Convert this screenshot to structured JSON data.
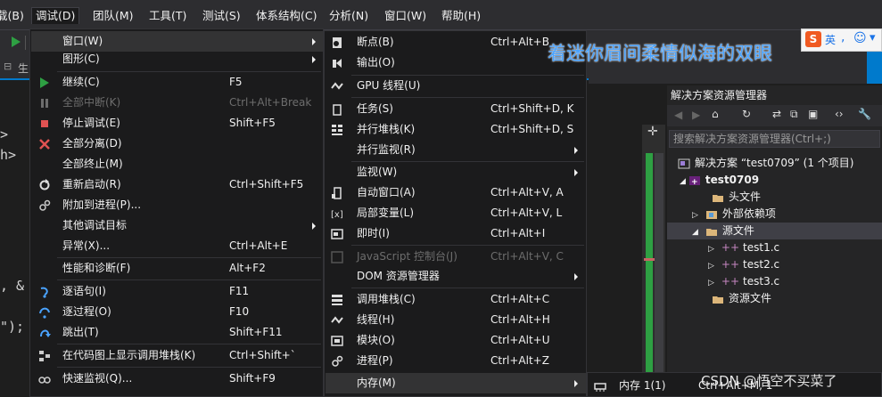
{
  "menubar": {
    "items": [
      "载(B)",
      "调试(D)",
      "团队(M)",
      "工具(T)",
      "测试(S)",
      "体系结构(C)",
      "分析(N)",
      "窗口(W)",
      "帮助(H)"
    ]
  },
  "toolbar": {
    "tab_label": "生"
  },
  "editor": {
    "lines": [
      ">",
      "h>",
      ", &",
      "\");"
    ]
  },
  "overlay_text": "着迷你眉间柔情似海的双眼",
  "ime": {
    "logo": "S",
    "label": "英"
  },
  "debug_menu": {
    "items": [
      {
        "label": "窗口(W)",
        "shortcut": "",
        "submenu": true,
        "icon": "",
        "disabled": false,
        "highlight": true
      },
      {
        "label": "图形(C)",
        "shortcut": "",
        "submenu": true,
        "icon": "",
        "disabled": false
      },
      {
        "label": "继续(C)",
        "shortcut": "F5",
        "icon": "play-icon",
        "disabled": false
      },
      {
        "label": "全部中断(K)",
        "shortcut": "Ctrl+Alt+Break",
        "icon": "pause-icon",
        "disabled": true
      },
      {
        "label": "停止调试(E)",
        "shortcut": "Shift+F5",
        "icon": "stop-icon",
        "disabled": false
      },
      {
        "label": "全部分离(D)",
        "shortcut": "",
        "icon": "detach-icon",
        "disabled": false
      },
      {
        "label": "全部终止(M)",
        "shortcut": "",
        "icon": "",
        "disabled": false
      },
      {
        "label": "重新启动(R)",
        "shortcut": "Ctrl+Shift+F5",
        "icon": "restart-icon",
        "disabled": false
      },
      {
        "label": "附加到进程(P)...",
        "shortcut": "",
        "icon": "attach-icon",
        "disabled": false
      },
      {
        "label": "其他调试目标",
        "shortcut": "",
        "submenu": true,
        "icon": "",
        "disabled": false
      },
      {
        "label": "异常(X)...",
        "shortcut": "Ctrl+Alt+E",
        "icon": "",
        "disabled": false
      },
      {
        "label": "性能和诊断(F)",
        "shortcut": "Alt+F2",
        "icon": "",
        "disabled": false
      },
      {
        "label": "逐语句(I)",
        "shortcut": "F11",
        "icon": "step-into-icon",
        "disabled": false
      },
      {
        "label": "逐过程(O)",
        "shortcut": "F10",
        "icon": "step-over-icon",
        "disabled": false
      },
      {
        "label": "跳出(T)",
        "shortcut": "Shift+F11",
        "icon": "step-out-icon",
        "disabled": false
      },
      {
        "label": "在代码图上显示调用堆栈(K)",
        "shortcut": "Ctrl+Shift+`",
        "icon": "code-map-icon",
        "disabled": false
      },
      {
        "label": "快速监视(Q)...",
        "shortcut": "Shift+F9",
        "icon": "glasses-icon",
        "disabled": false
      }
    ]
  },
  "window_submenu": {
    "items": [
      {
        "label": "断点(B)",
        "shortcut": "Ctrl+Alt+B",
        "icon": "breakpoints-icon"
      },
      {
        "label": "输出(O)",
        "shortcut": "",
        "icon": "output-icon"
      },
      {
        "label": "GPU 线程(U)",
        "shortcut": "",
        "icon": "gpu-threads-icon"
      },
      {
        "label": "任务(S)",
        "shortcut": "Ctrl+Shift+D, K",
        "icon": "tasks-icon"
      },
      {
        "label": "并行堆栈(K)",
        "shortcut": "Ctrl+Shift+D, S",
        "icon": "parallel-stacks-icon"
      },
      {
        "label": "并行监视(R)",
        "shortcut": "",
        "submenu": true,
        "icon": ""
      },
      {
        "label": "监视(W)",
        "shortcut": "",
        "submenu": true,
        "icon": ""
      },
      {
        "label": "自动窗口(A)",
        "shortcut": "Ctrl+Alt+V, A",
        "icon": "autos-icon"
      },
      {
        "label": "局部变量(L)",
        "shortcut": "Ctrl+Alt+V, L",
        "icon": "locals-icon"
      },
      {
        "label": "即时(I)",
        "shortcut": "Ctrl+Alt+I",
        "icon": "immediate-icon"
      },
      {
        "label": "JavaScript 控制台(J)",
        "shortcut": "Ctrl+Alt+V, C",
        "icon": "js-console-icon",
        "disabled": true
      },
      {
        "label": "DOM 资源管理器",
        "shortcut": "",
        "submenu": true,
        "icon": ""
      },
      {
        "label": "调用堆栈(C)",
        "shortcut": "Ctrl+Alt+C",
        "icon": "call-stack-icon"
      },
      {
        "label": "线程(H)",
        "shortcut": "Ctrl+Alt+H",
        "icon": "threads-icon"
      },
      {
        "label": "模块(O)",
        "shortcut": "Ctrl+Alt+U",
        "icon": "modules-icon"
      },
      {
        "label": "进程(P)",
        "shortcut": "Ctrl+Alt+Z",
        "icon": "processes-icon"
      },
      {
        "label": "内存(M)",
        "shortcut": "",
        "submenu": true,
        "icon": "",
        "highlight": true
      }
    ]
  },
  "memory_submenu": {
    "label": "内存 1(1)",
    "shortcut": "Ctrl+Alt+M, 1"
  },
  "solution_explorer": {
    "title": "解决方案资源管理器",
    "search_placeholder": "搜索解决方案资源管理器(Ctrl+;)",
    "tree": [
      {
        "label": "解决方案 “test0709” (1 个项目)",
        "indent": 0
      },
      {
        "label": "test0709",
        "indent": 1,
        "bold": true
      },
      {
        "label": "头文件",
        "indent": 2
      },
      {
        "label": "外部依赖项",
        "indent": 2
      },
      {
        "label": "源文件",
        "indent": 2,
        "selected": true
      },
      {
        "label": "test1.c",
        "indent": 3
      },
      {
        "label": "test2.c",
        "indent": 3
      },
      {
        "label": "test3.c",
        "indent": 3
      },
      {
        "label": "资源文件",
        "indent": 2
      }
    ]
  },
  "watermark": "CSDN @悟空不买菜了",
  "colors": {
    "accent": "#007acc",
    "bg": "#1e1e1e",
    "menu_bg": "#1b1b1c",
    "highlight": "#333334",
    "green": "#2ea043"
  }
}
